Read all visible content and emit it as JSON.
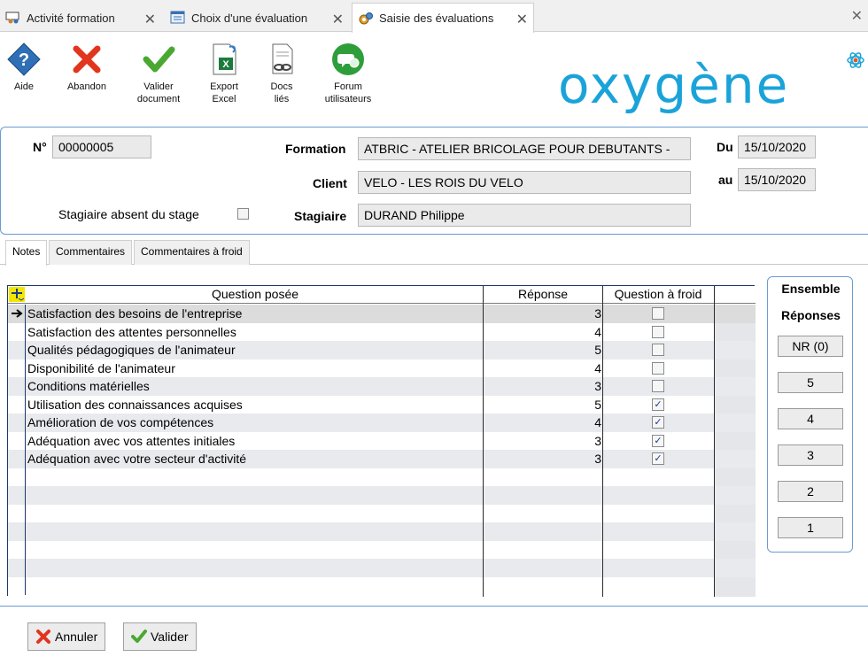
{
  "tabs": [
    {
      "label": "Activité formation",
      "icon": "training-icon"
    },
    {
      "label": "Choix d'une évaluation",
      "icon": "list-window-icon"
    },
    {
      "label": "Saisie des évaluations",
      "icon": "gears-icon",
      "active": true
    }
  ],
  "toolbar": {
    "help": "Aide",
    "abandon": "Abandon",
    "validate_line1": "Valider",
    "validate_line2": "document",
    "export_line1": "Export",
    "export_line2": "Excel",
    "docs_line1": "Docs",
    "docs_line2": "liés",
    "forum_line1": "Forum",
    "forum_line2": "utilisateurs"
  },
  "brand": {
    "logo_text": "oxygène",
    "color": "#1aa3d9"
  },
  "header": {
    "numero_label": "N°",
    "numero_value": "00000005",
    "formation_label": "Formation",
    "formation_value": "ATBRIC - ATELIER BRICOLAGE POUR DEBUTANTS -",
    "client_label": "Client",
    "client_value": "VELO - LES ROIS DU VELO",
    "stagiaire_label": "Stagiaire",
    "stagiaire_value": "DURAND Philippe",
    "absent_label": "Stagiaire absent du stage",
    "absent_checked": false,
    "du_label": "Du",
    "du_value": "15/10/2020",
    "au_label": "au",
    "au_value": "15/10/2020"
  },
  "subtabs": [
    "Notes",
    "Commentaires",
    "Commentaires à froid"
  ],
  "grid": {
    "columns": [
      "Question posée",
      "Réponse",
      "Question à froid"
    ],
    "rows": [
      {
        "question": "Satisfaction des besoins de l'entreprise",
        "reponse": "3",
        "froid": false
      },
      {
        "question": "Satisfaction des attentes personnelles",
        "reponse": "4",
        "froid": false
      },
      {
        "question": "Qualités pédagogiques de l'animateur",
        "reponse": "5",
        "froid": false
      },
      {
        "question": "Disponibilité de l'animateur",
        "reponse": "4",
        "froid": false
      },
      {
        "question": "Conditions matérielles",
        "reponse": "3",
        "froid": false
      },
      {
        "question": "Utilisation des connaissances acquises",
        "reponse": "5",
        "froid": true
      },
      {
        "question": "Amélioration de vos compétences",
        "reponse": "4",
        "froid": true
      },
      {
        "question": "Adéquation avec vos attentes initiales",
        "reponse": "3",
        "froid": true
      },
      {
        "question": "Adéquation avec votre secteur d'activité",
        "reponse": "3",
        "froid": true
      }
    ],
    "empty_rows": 7
  },
  "ensemble": {
    "title1": "Ensemble",
    "title2": "Réponses",
    "buttons": [
      "NR (0)",
      "5",
      "4",
      "3",
      "2",
      "1"
    ]
  },
  "footer": {
    "cancel": "Annuler",
    "validate": "Valider"
  }
}
